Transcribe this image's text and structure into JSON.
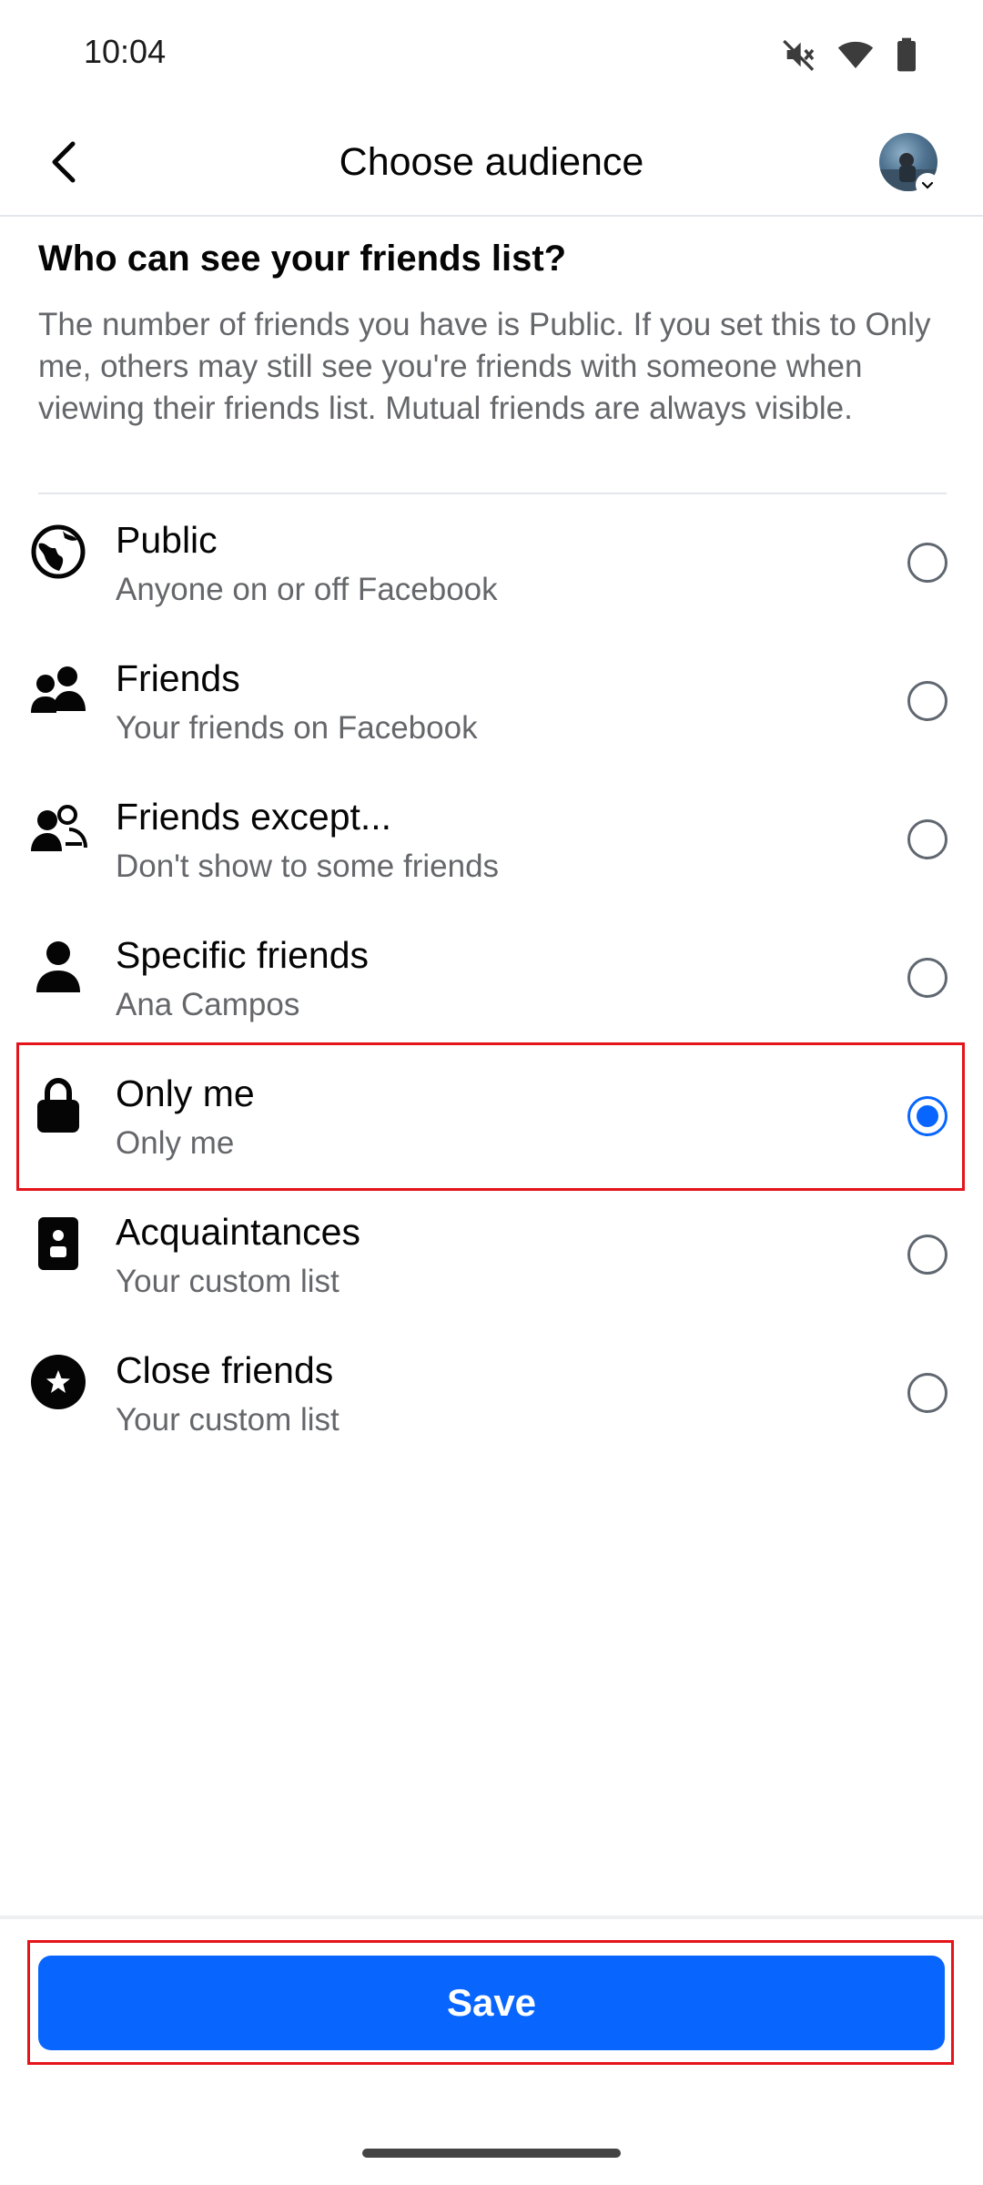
{
  "status_bar": {
    "time": "10:04",
    "icons": [
      "mute-icon",
      "wifi-icon",
      "battery-icon"
    ]
  },
  "header": {
    "title": "Choose audience",
    "back_icon": "back-arrow-icon",
    "avatar_icon": "profile-avatar"
  },
  "question": "Who can see your friends list?",
  "description": "The number of friends you have is Public. If you set this to Only me, others may still see you're friends with someone when viewing their friends list. Mutual friends are always visible.",
  "options": [
    {
      "title": "Public",
      "subtitle": "Anyone on or off Facebook",
      "icon": "globe-icon",
      "selected": false
    },
    {
      "title": "Friends",
      "subtitle": "Your friends on Facebook",
      "icon": "friends-icon",
      "selected": false
    },
    {
      "title": "Friends except...",
      "subtitle": "Don't show to some friends",
      "icon": "friends-except-icon",
      "selected": false
    },
    {
      "title": "Specific friends",
      "subtitle": "Ana Campos",
      "icon": "person-icon",
      "selected": false
    },
    {
      "title": "Only me",
      "subtitle": "Only me",
      "icon": "lock-icon",
      "selected": true
    },
    {
      "title": "Acquaintances",
      "subtitle": "Your custom list",
      "icon": "id-badge-icon",
      "selected": false
    },
    {
      "title": "Close friends",
      "subtitle": "Your custom list",
      "icon": "star-circle-icon",
      "selected": false
    }
  ],
  "footer": {
    "save_label": "Save"
  },
  "colors": {
    "accent": "#0866ff",
    "highlight": "#e5141b",
    "secondary_text": "#65676b"
  }
}
